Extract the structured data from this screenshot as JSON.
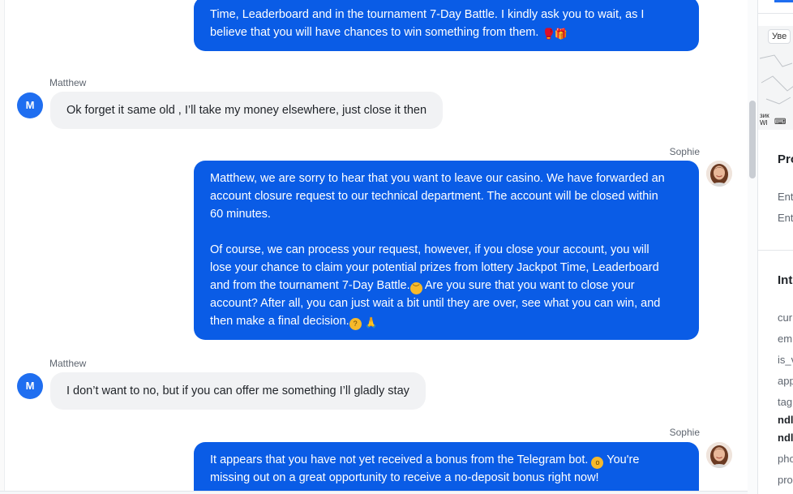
{
  "messages": {
    "m1": {
      "lines": [
        "Time, Leaderboard and in the tournament 7-Day Battle. I kindly ask you to wait, as I",
        "believe that you will have chances to win something from them."
      ]
    },
    "m2": {
      "sender": "Matthew",
      "avatar_initial": "M",
      "text": "Ok forget it same old , I’ll take my money elsewhere, just close it then"
    },
    "m3": {
      "sender": "Sophie",
      "lines": [
        "Matthew, we are sorry to hear that you want to leave our casino. We have forwarded an",
        "account closure request to our technical department. The account will be closed within",
        "60 minutes.",
        "",
        "Of course, we can process your request, however, if you close your account, you will",
        "lose your chance to claim your potential prizes from lottery Jackpot Time, Leaderboard",
        "and from the tournament 7-Day Battle.",
        "Are you sure that you want to close your",
        "account? After all, you can just wait a bit until they are over, see what you can win, and",
        "then make a final decision."
      ]
    },
    "m4": {
      "sender": "Matthew",
      "avatar_initial": "M",
      "text": "I don’t want to no, but if you can offer me something I’ll gladly stay"
    },
    "m5": {
      "sender": "Sophie",
      "lines": [
        "It appears that you have not yet received a bonus from the Telegram bot.",
        "You're",
        "missing out on a great opportunity to receive a no-deposit bonus right now!"
      ]
    }
  },
  "right_panel": {
    "tooltip": "Уве",
    "key_labels": [
      "зик",
      "WI"
    ],
    "section1_title": "Pro",
    "section1_items": [
      "Ent",
      "Ent"
    ],
    "section2_title": "Int",
    "section2_items": [
      "cur",
      "em",
      "is_v",
      "app",
      "tag"
    ],
    "section2_tags": [
      "ndl",
      "ndl"
    ],
    "section2_more": [
      "pho",
      "pro"
    ]
  },
  "colors": {
    "agent_bubble": "#0a5ce6",
    "customer_bubble": "#f1f2f4",
    "customer_avatar": "#1f6ef0"
  }
}
